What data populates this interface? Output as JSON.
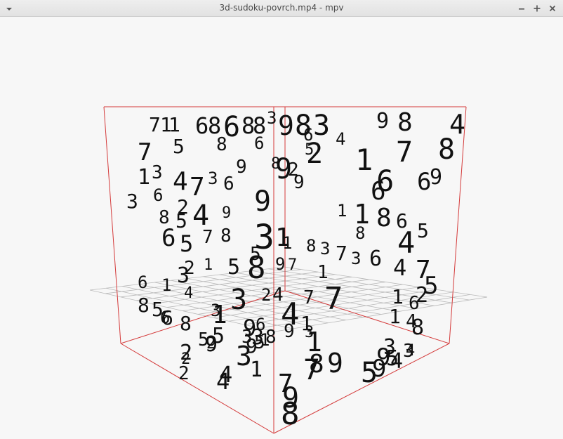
{
  "window": {
    "title": "3d-sudoku-povrch.mp4 - mpv",
    "menu_icon": "chevron-down-icon",
    "minimize_icon": "minimize-icon",
    "maximize_icon": "maximize-icon",
    "close_icon": "close-icon"
  },
  "scene": {
    "frame_color": "#d43a3a",
    "grid_color": "#b9b9b9",
    "digits": [
      "7",
      "1",
      "1",
      "6",
      "8",
      "6",
      "8",
      "8",
      "3",
      "9",
      "8",
      "3",
      "9",
      "8",
      "4",
      "7",
      "5",
      "8",
      "6",
      "6",
      "5",
      "2",
      "4",
      "1",
      "7",
      "8",
      "9",
      "8",
      "9",
      "2",
      "9",
      "6",
      "1",
      "3",
      "4",
      "7",
      "3",
      "6",
      "6",
      "6",
      "9",
      "3",
      "9",
      "6",
      "2",
      "4",
      "9",
      "1",
      "1",
      "8",
      "6",
      "8",
      "5",
      "6",
      "5",
      "7",
      "8",
      "3",
      "5",
      "1",
      "1",
      "8",
      "5",
      "8",
      "3",
      "7",
      "3",
      "6",
      "4",
      "2",
      "1",
      "5",
      "8",
      "9",
      "7",
      "1",
      "4",
      "7",
      "3",
      "6",
      "1",
      "4",
      "5",
      "2",
      "6",
      "8",
      "5",
      "6",
      "8",
      "1",
      "3",
      "3",
      "4",
      "7",
      "7",
      "2",
      "1",
      "1",
      "8",
      "6",
      "9",
      "5",
      "3",
      "6",
      "4",
      "9",
      "1",
      "3",
      "1",
      "9",
      "4",
      "2",
      "5",
      "9",
      "3",
      "1",
      "8",
      "5",
      "3",
      "3",
      "2",
      "5",
      "4",
      "2",
      "8",
      "7",
      "9",
      "3",
      "1",
      "4",
      "5",
      "9",
      "7",
      "9",
      "4",
      "2",
      "4",
      "9",
      "8"
    ]
  }
}
